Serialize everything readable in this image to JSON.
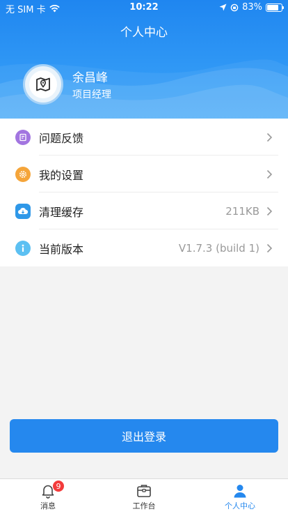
{
  "status_bar": {
    "carrier": "无 SIM 卡",
    "time": "10:22",
    "battery": "83%",
    "battery_level": 0.83
  },
  "header": {
    "title": "个人中心"
  },
  "user": {
    "name": "余昌峰",
    "role": "项目经理"
  },
  "menu": [
    {
      "label": "问题反馈",
      "value": "",
      "icon": "feedback-icon",
      "color": "#a275e0"
    },
    {
      "label": "我的设置",
      "value": "",
      "icon": "gear-icon",
      "color": "#f5a53a"
    },
    {
      "label": "清理缓存",
      "value": "211KB",
      "icon": "cloud-download-icon",
      "color": "#2f98e8"
    },
    {
      "label": "当前版本",
      "value": "V1.7.3 (build 1)",
      "icon": "info-icon",
      "color": "#5cc0f2"
    }
  ],
  "logout_label": "退出登录",
  "tabs": [
    {
      "label": "消息",
      "badge": "9",
      "icon": "bell-icon"
    },
    {
      "label": "工作台",
      "icon": "toolbox-icon"
    },
    {
      "label": "个人中心",
      "icon": "person-icon",
      "active": true
    }
  ],
  "colors": {
    "primary": "#2588ee",
    "badge": "#f33b3b"
  }
}
